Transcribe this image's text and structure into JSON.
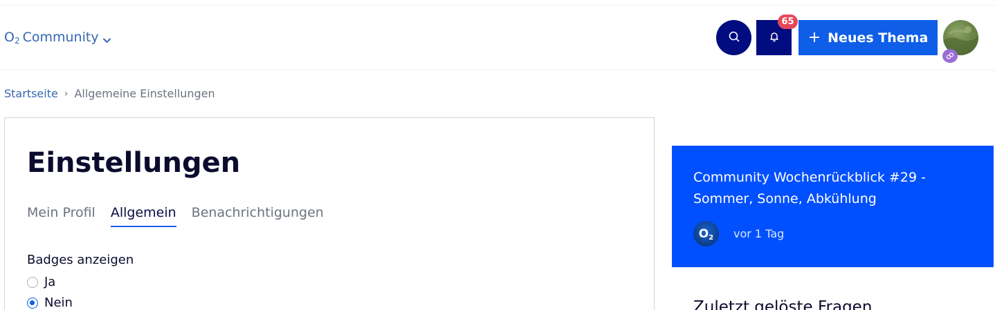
{
  "header": {
    "brand_main": "O",
    "brand_sub": "2",
    "brand_rest": "Community",
    "notifications_count": "65",
    "new_topic_label": "Neues Thema",
    "icons": {
      "search": "search-icon",
      "bell": "bell-icon",
      "plus": "plus-icon",
      "chevron": "chevron-down-icon",
      "avatar_badge": "rank-badge-icon"
    }
  },
  "breadcrumb": {
    "home": "Startseite",
    "current": "Allgemeine Einstellungen"
  },
  "settings": {
    "title": "Einstellungen",
    "tabs": [
      {
        "label": "Mein Profil",
        "active": false
      },
      {
        "label": "Allgemein",
        "active": true
      },
      {
        "label": "Benachrichtigungen",
        "active": false
      }
    ],
    "badges_label": "Badges anzeigen",
    "options": [
      {
        "label": "Ja",
        "checked": false
      },
      {
        "label": "Nein",
        "checked": true
      }
    ]
  },
  "sidebar": {
    "promo_title": "Community Wochenrückblick #29 - Sommer, Sonne, Abkühlung",
    "promo_avatar_main": "O",
    "promo_avatar_sub": "2",
    "promo_time": "vor 1 Tag",
    "solved_heading": "Zuletzt gelöste Fragen"
  },
  "colors": {
    "navy": "#000c80",
    "brand_blue": "#0f5ee8",
    "promo_blue": "#0050ff",
    "badge_red": "#e5485b",
    "link_blue": "#3468b0"
  }
}
